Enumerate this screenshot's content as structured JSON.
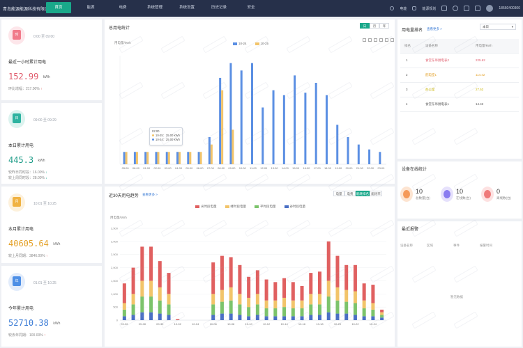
{
  "header": {
    "brand": "青岛能源能源科技有限公司",
    "nav": [
      "首页",
      "能源",
      "电费",
      "系统管理",
      "系统设置",
      "历史记录",
      "安全"
    ],
    "active_nav": 0,
    "right": {
      "item1": "电能",
      "item2": "能源规划",
      "phone": "18560400300"
    }
  },
  "cards": [
    {
      "time": "0:00 至 09:00",
      "title": "最近一小时累计用电",
      "value": "152.99",
      "unit": "kWh",
      "sub1": "环比增幅：217.00%",
      "sub1_dir": "up",
      "sub2": "",
      "sub2_dir": "",
      "icon_text": "时",
      "color": "#f17a8a",
      "bg": "#fde6ea",
      "value_color": "#e05a6b"
    },
    {
      "time": "09:00 至 09:29",
      "title": "本日累计用电",
      "value": "445.3",
      "unit": "kWh",
      "sub1": "较昨日同时段：16.00%",
      "sub1_dir": "down",
      "sub2": "较上周同时段：28.00%",
      "sub2_dir": "down",
      "icon_text": "日",
      "color": "#2db3a0",
      "bg": "#dcf3ef",
      "value_color": "#1e9c88"
    },
    {
      "time": "10.01 至 10.25",
      "title": "本月累计用电",
      "value": "40605.64",
      "unit": "kWh",
      "sub1": "较上月同期：3846.00%",
      "sub1_dir": "up",
      "sub2": "",
      "sub2_dir": "",
      "icon_text": "月",
      "color": "#f0b242",
      "bg": "#fdf1dc",
      "value_color": "#e4a22a"
    },
    {
      "time": "01.01 至 10.25",
      "title": "今年累计用电",
      "value": "52710.38",
      "unit": "kWh",
      "sub1": "较去年同期：100.00%",
      "sub1_dir": "up",
      "sub2": "",
      "sub2_dir": "",
      "icon_text": "年",
      "color": "#4d8fe6",
      "bg": "#e2ecfb",
      "value_color": "#3a7bd5"
    }
  ],
  "hourly": {
    "title": "总用电统计",
    "toggles": [
      "日",
      "月",
      "年"
    ],
    "active_toggle": 0,
    "ylabel": "用电量/kWh",
    "legend": [
      "10-24",
      "10-25"
    ],
    "colors": {
      "a": "#5b8fe3",
      "b": "#f2c46a"
    },
    "tooltip": {
      "time": "02:00",
      "line1": "10-25：25.00 kWh",
      "line2": "10-24：25.00 kWh"
    }
  },
  "chart_data": [
    {
      "type": "bar",
      "title": "总用电统计",
      "ylabel": "用电量/kWh",
      "categories": [
        "05:00",
        "06:00",
        "01:00",
        "02:00",
        "03:00",
        "04:00",
        "05:00",
        "06:00",
        "07:00",
        "08:00",
        "09:00",
        "10:00",
        "11:00",
        "12:00",
        "13:00",
        "14:00",
        "15:00",
        "16:00",
        "17:00",
        "18:00",
        "19:00",
        "20:00",
        "21:00",
        "22:00",
        "23:00"
      ],
      "series": [
        {
          "name": "10-24",
          "values": [
            25,
            25,
            25,
            25,
            25,
            25,
            25,
            25,
            55,
            175,
            205,
            190,
            205,
            115,
            150,
            140,
            180,
            145,
            165,
            140,
            80,
            55,
            40,
            30,
            25
          ]
        },
        {
          "name": "10-25",
          "values": [
            25,
            25,
            25,
            25,
            25,
            25,
            25,
            25,
            40,
            150,
            70,
            0,
            0,
            0,
            0,
            0,
            0,
            0,
            0,
            0,
            0,
            0,
            0,
            0,
            0
          ]
        }
      ],
      "ylim": [
        0,
        220
      ]
    },
    {
      "type": "bar",
      "title": "近30天用电趋势",
      "ylabel": "用电量/kWh",
      "categories": [
        "09-26",
        "09-27",
        "09-28",
        "09-29",
        "09-30",
        "10-01",
        "10-02",
        "10-03",
        "10-04",
        "10-05",
        "10-06",
        "10-07",
        "10-08",
        "10-09",
        "10-10",
        "10-11",
        "10-12",
        "10-13",
        "10-14",
        "10-15",
        "10-16",
        "10-17",
        "10-18",
        "10-19",
        "10-20",
        "10-21",
        "10-22",
        "10-23",
        "10-24",
        "10-25"
      ],
      "x_tick_labels": [
        "09-26",
        "09-28",
        "09-30",
        "10-02",
        "10-04",
        "10-06",
        "10-08",
        "10-10",
        "10-12",
        "10-14",
        "10-16",
        "10-18",
        "10-20",
        "10-22",
        "10-24"
      ],
      "stacked": true,
      "series": [
        {
          "name": "谷时段电量",
          "values": [
            150,
            200,
            300,
            300,
            250,
            200,
            0,
            0,
            0,
            0,
            200,
            250,
            250,
            200,
            150,
            200,
            150,
            150,
            150,
            150,
            150,
            200,
            200,
            300,
            250,
            250,
            200,
            150,
            150,
            100
          ]
        },
        {
          "name": "平时段电量",
          "values": [
            250,
            400,
            600,
            600,
            500,
            400,
            0,
            0,
            0,
            0,
            400,
            450,
            500,
            400,
            350,
            400,
            300,
            300,
            350,
            300,
            300,
            400,
            400,
            600,
            500,
            450,
            450,
            300,
            250,
            100
          ]
        },
        {
          "name": "峰时段电量",
          "values": [
            250,
            400,
            600,
            600,
            500,
            400,
            0,
            0,
            0,
            0,
            400,
            450,
            500,
            400,
            350,
            400,
            300,
            300,
            350,
            300,
            300,
            400,
            400,
            600,
            500,
            450,
            450,
            300,
            250,
            100
          ]
        },
        {
          "name": "尖时段电量",
          "values": [
            750,
            1000,
            1300,
            1300,
            1000,
            800,
            40,
            0,
            0,
            0,
            1200,
            1300,
            1150,
            1100,
            800,
            900,
            800,
            700,
            750,
            700,
            550,
            800,
            850,
            1500,
            1200,
            950,
            1000,
            650,
            700,
            100
          ]
        }
      ],
      "ylim": [
        0,
        3500
      ]
    }
  ],
  "trend": {
    "title": "近30天用电趋势",
    "link": "查看更多 >",
    "toggles": [
      "电量",
      "电费",
      "能耗排名",
      "能耗率"
    ],
    "active_toggle": 2,
    "ylabel": "用电量/kWh",
    "legend": [
      "尖时段电量",
      "峰时段电量",
      "平时段电量",
      "谷时段电量"
    ],
    "colors": [
      "#e06060",
      "#f2c46a",
      "#7cc36b",
      "#4a6fc4"
    ],
    "yticks": [
      "0",
      "500",
      "1,000",
      "1,500",
      "2,000",
      "2,500",
      "3,000",
      "3,500"
    ]
  },
  "ranking": {
    "title": "用电量排名",
    "link": "查看更多 >",
    "select": "本日",
    "headers": [
      "排名",
      "设备名称",
      "用电量/kWh"
    ],
    "rows": [
      {
        "rank": "1",
        "name": "食堂东吊厨电表2",
        "value": "225.62",
        "color": "#e05a6b"
      },
      {
        "rank": "2",
        "name": "配电室1",
        "value": "114.42",
        "color": "#e4a22a"
      },
      {
        "rank": "3",
        "name": "办公室",
        "value": "27.52",
        "color": "#c9b300"
      },
      {
        "rank": "4",
        "name": "食堂东吊厨电表1",
        "value": "14.42",
        "color": "#555555"
      }
    ]
  },
  "status": {
    "title": "设备在线统计",
    "items": [
      {
        "num": "10",
        "label": "总数量(台)",
        "color": "#f59a5a",
        "bg": "#fde4d1"
      },
      {
        "num": "10",
        "label": "在线数(台)",
        "color": "#8a7cf0",
        "bg": "#e6e1fc"
      },
      {
        "num": "0",
        "label": "离线数(台)",
        "color": "#ef7a7a",
        "bg": "#fde1e1"
      }
    ]
  },
  "alarm": {
    "title": "最近报警",
    "headers": [
      "设备名称",
      "区域",
      "事件",
      "报警时间"
    ],
    "empty": "暂无数据"
  }
}
